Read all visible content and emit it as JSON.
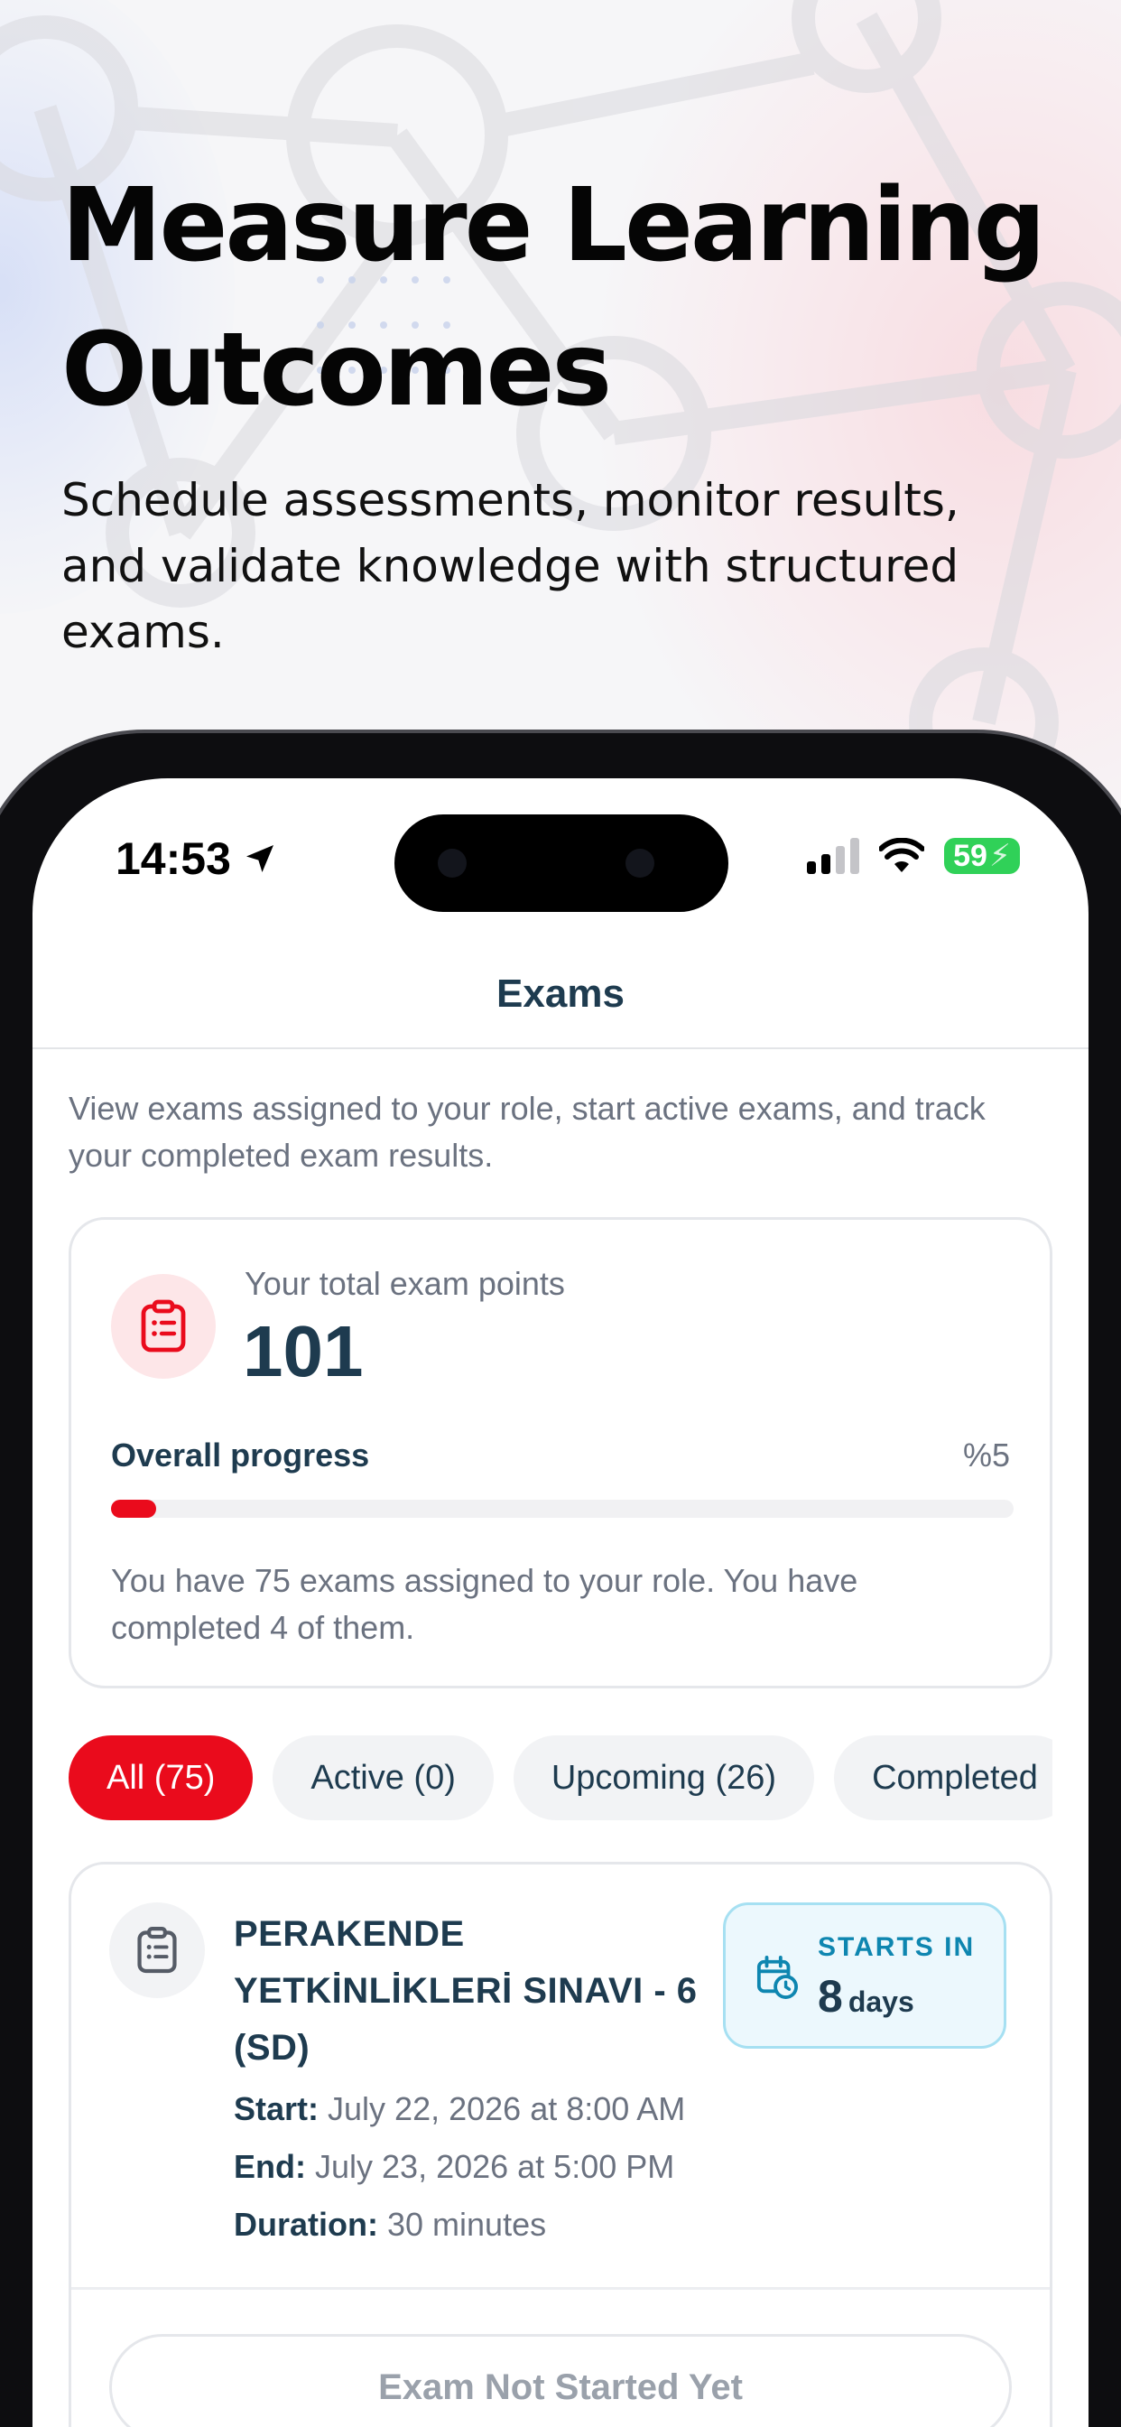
{
  "hero": {
    "title_line1": "Measure Learning",
    "title_line2": "Outcomes",
    "subtitle": "Schedule assessments, monitor results, and validate knowledge with structured exams."
  },
  "status_bar": {
    "time": "14:53",
    "battery": "59",
    "icons": [
      "location-arrow-icon",
      "signal-icon",
      "wifi-icon",
      "battery-icon"
    ]
  },
  "nav": {
    "title": "Exams"
  },
  "intro_text": "View exams assigned to your role, start active exams, and track your completed exam results.",
  "points_card": {
    "label": "Your total exam points",
    "value": "101",
    "progress_label": "Overall progress",
    "progress_pct_text": "%5",
    "progress_fraction": 0.05,
    "note": "You have 75 exams assigned to your role. You have completed 4 of them."
  },
  "filters": [
    {
      "label": "All (75)",
      "active": true
    },
    {
      "label": "Active (0)",
      "active": false
    },
    {
      "label": "Upcoming (26)",
      "active": false
    },
    {
      "label": "Completed",
      "active": false
    }
  ],
  "exam": {
    "title": "PERAKENDE YETKİNLİKLERİ SINAVI - 6 (SD)",
    "starts_label": "STARTS IN",
    "starts_value": "8",
    "starts_unit": "days",
    "start_label": "Start:",
    "start_value": "July 22, 2026 at 8:00 AM",
    "end_label": "End:",
    "end_value": "July 23, 2026 at 5:00 PM",
    "duration_label": "Duration:",
    "duration_value": "30 minutes",
    "button": "Exam Not Started Yet"
  },
  "colors": {
    "accent": "#ea0b1c",
    "navy": "#1e3b4f",
    "muted": "#6b7280",
    "info": "#0e86b0"
  }
}
